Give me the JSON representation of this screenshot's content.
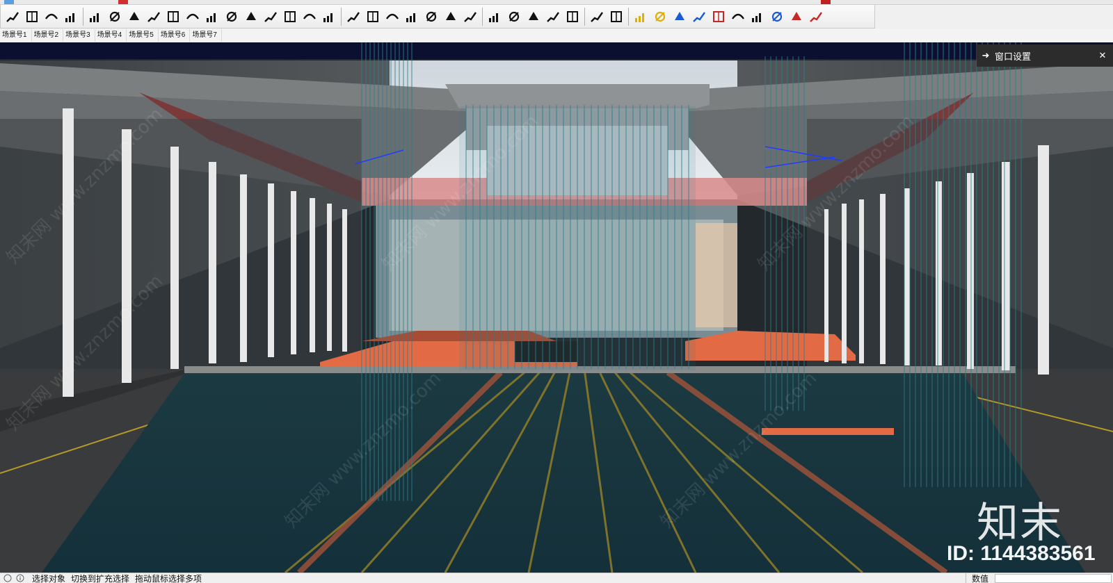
{
  "toolbar": {
    "groups": [
      [
        "stair-tool-icon",
        "column-tool-icon",
        "ramp-tool-icon",
        "bar-steps-icon"
      ],
      [
        "transform-icon",
        "align-icon",
        "arc-icon",
        "spline-icon",
        "loft-icon",
        "rotate-arrow-icon",
        "path-curve-icon",
        "solid-icon",
        "circle-slash-icon",
        "stack-icon",
        "layer-icon",
        "box-icon",
        "cube-icon"
      ],
      [
        "arch-icon",
        "wave-chain-icon",
        "wave-icon",
        "spiral-icon",
        "knife-icon",
        "comb-icon",
        "pillars-icon"
      ],
      [
        "mirror-icon",
        "grid-dots-icon",
        "panel-icon",
        "pin-icon",
        "brush-icon"
      ],
      [
        "render-a-icon",
        "render-b-icon"
      ],
      [
        "color-cube-a-icon",
        "color-cube-b-icon",
        "column-blue-icon",
        "up-down-blue-icon",
        "up-down-red-icon",
        "line-link-icon",
        "select-box-icon",
        "undo-blue-icon",
        "undo-red-icon",
        "erase-red-icon"
      ]
    ]
  },
  "scene_tabs": [
    "场景号1",
    "场景号2",
    "场景号3",
    "场景号4",
    "场景号5",
    "场景号6",
    "场景号7"
  ],
  "panel": {
    "title": "窗口设置",
    "arrow_glyph": "➜",
    "close_glyph": "✕"
  },
  "watermark": {
    "logo_text": "知末",
    "id_text": "ID: 1144383561",
    "diagonal_text": "知末网 www.znzmo.com"
  },
  "status": {
    "messages": [
      "选择对象",
      "切换到扩充选择",
      "拖动鼠标选择多项"
    ],
    "right_label": "数值",
    "value": ""
  },
  "colors": {
    "water": "#1f3c44",
    "copper": "#e26a45",
    "curtain": "#2f7d8c",
    "paving": "#3a3b3c",
    "wall_red": "#7a3a3a"
  }
}
